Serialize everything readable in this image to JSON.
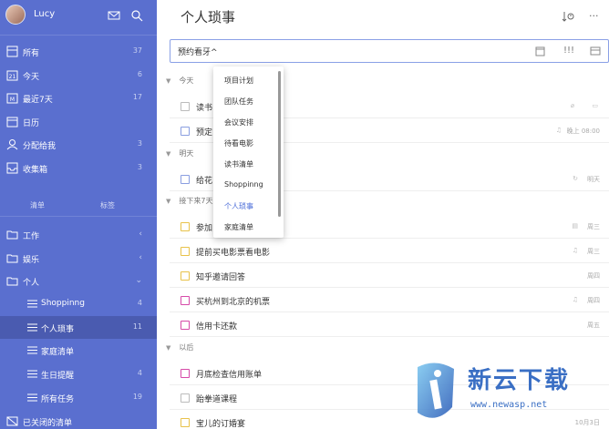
{
  "sidebar": {
    "username": "Lucy",
    "smart_lists": [
      {
        "label": "所有",
        "count": "37"
      },
      {
        "label": "今天",
        "count": "6"
      },
      {
        "label": "最近7天",
        "count": "17"
      },
      {
        "label": "日历",
        "count": ""
      },
      {
        "label": "分配给我",
        "count": "3"
      },
      {
        "label": "收集箱",
        "count": "3"
      }
    ],
    "tabs": {
      "lists": "清单",
      "tags": "标签"
    },
    "folders": [
      {
        "label": "工作",
        "chevron": "‹"
      },
      {
        "label": "娱乐",
        "chevron": "‹"
      },
      {
        "label": "个人",
        "chevron": "⌄"
      }
    ],
    "sub_lists": [
      {
        "label": "Shoppinng",
        "count": "4"
      },
      {
        "label": "个人琐事",
        "count": "11"
      },
      {
        "label": "家庭清单",
        "count": ""
      },
      {
        "label": "生日提醒",
        "count": "4"
      },
      {
        "label": "所有任务",
        "count": "19"
      }
    ],
    "closed_lists": "已关闭的清单"
  },
  "main": {
    "title": "个人琐事",
    "input_value": "预约看牙^",
    "sections": [
      {
        "label": "今天"
      },
      {
        "label": "明天"
      },
      {
        "label": "接下来7天"
      },
      {
        "label": "以后"
      }
    ],
    "tasks": [
      {
        "text": "读书",
        "meta": "",
        "color": "#bbbbbb"
      },
      {
        "text": "预定",
        "meta": "晚上 08:00",
        "color": "#8a9ee0"
      },
      {
        "text": "给花",
        "meta": "明天",
        "color": "#8a9ee0"
      },
      {
        "text": "参加",
        "meta": "周三",
        "color": "#e8c24a"
      },
      {
        "text": "提前买电影票看电影",
        "meta": "周三",
        "color": "#e8c24a"
      },
      {
        "text": "知乎邀请回答",
        "meta": "周四",
        "color": "#e8c24a"
      },
      {
        "text": "买杭州到北京的机票",
        "meta": "周四",
        "color": "#d64aa8"
      },
      {
        "text": "信用卡还款",
        "meta": "周五",
        "color": "#d64aa8"
      },
      {
        "text": "月底检查信用账单",
        "meta": "",
        "color": "#d64aa8"
      },
      {
        "text": "跆拳道课程",
        "meta": "",
        "color": "#bbbbbb"
      },
      {
        "text": "宝儿的订婚宴",
        "meta": "10月3日",
        "color": "#e8c24a"
      }
    ]
  },
  "dropdown": {
    "items": [
      "项目计划",
      "团队任务",
      "会议安排",
      "待看电影",
      "读书清单",
      "Shoppinng",
      "个人琐事",
      "家庭清单"
    ],
    "selected_index": 6
  },
  "watermark": {
    "text": "新云下载",
    "url": "www.newasp.net"
  }
}
